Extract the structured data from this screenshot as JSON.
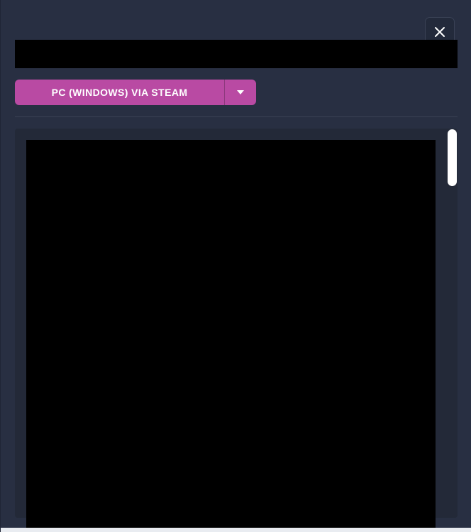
{
  "dialog": {
    "close_icon": "close-icon",
    "platform_select": {
      "selected": "PC (WINDOWS) VIA STEAM",
      "toggle_icon": "caret-down-icon",
      "accent": "#b94aa3"
    }
  },
  "colors": {
    "background": "#282f42",
    "panel": "#232938",
    "accent": "#b94aa3"
  }
}
